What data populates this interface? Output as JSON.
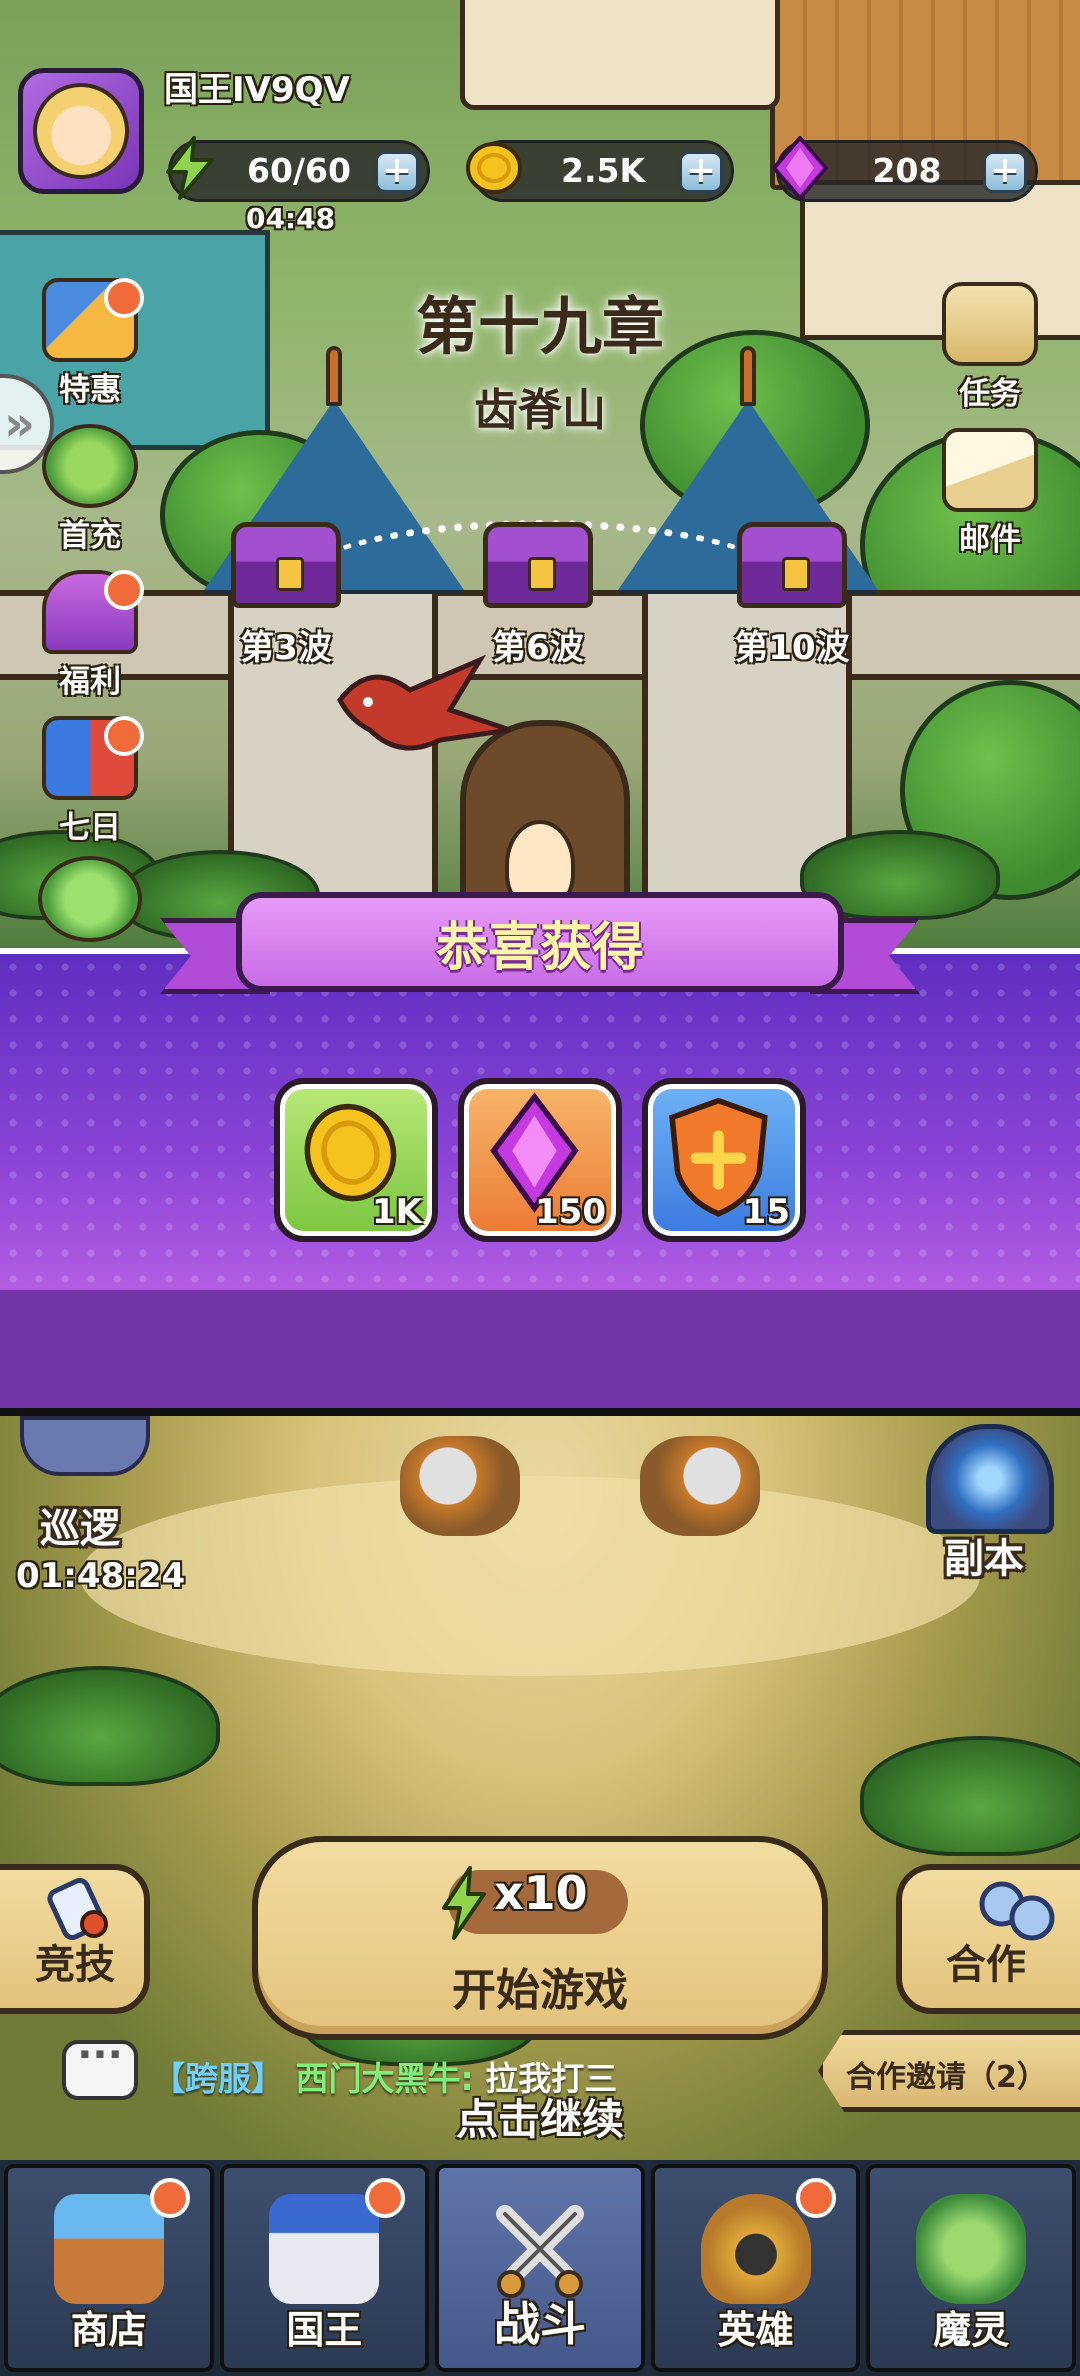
{
  "player": {
    "name": "国王IV9QV"
  },
  "resources": {
    "energy": {
      "value": "60/60",
      "timer": "04:48"
    },
    "gold": {
      "value": "2.5K"
    },
    "gems": {
      "value": "208"
    }
  },
  "chapter": {
    "title": "第十九章",
    "name": "齿脊山"
  },
  "left_menu": [
    {
      "label": "特惠",
      "badge": true
    },
    {
      "label": "首充",
      "badge": false
    },
    {
      "label": "福利",
      "badge": true
    },
    {
      "label": "七日",
      "badge": true
    }
  ],
  "right_menu": [
    {
      "label": "任务"
    },
    {
      "label": "邮件"
    }
  ],
  "wave_chests": [
    {
      "label": "第3波"
    },
    {
      "label": "第6波"
    },
    {
      "label": "第10波"
    }
  ],
  "reward_popup": {
    "title": "恭喜获得",
    "items": [
      {
        "icon": "gold-coin-icon",
        "count": "1K"
      },
      {
        "icon": "purple-gem-icon",
        "count": "150"
      },
      {
        "icon": "shield-icon",
        "count": "15"
      }
    ]
  },
  "patrol": {
    "label": "巡逻",
    "timer": "01:48:24"
  },
  "dungeon": {
    "label": "副本"
  },
  "start_game": {
    "cost": "x10",
    "label": "开始游戏"
  },
  "arena": {
    "label": "竞技"
  },
  "coop": {
    "label": "合作",
    "invite_label": "合作邀请（2）"
  },
  "chat": {
    "channel": "【跨服】",
    "sender": "西门大黑牛:",
    "message": "拉我打三"
  },
  "continue_hint": "点击继续",
  "bottom_nav": [
    {
      "label": "商店",
      "badge": true,
      "active": false
    },
    {
      "label": "国王",
      "badge": true,
      "active": false
    },
    {
      "label": "战斗",
      "badge": false,
      "active": true
    },
    {
      "label": "英雄",
      "badge": true,
      "active": false
    },
    {
      "label": "魔灵",
      "badge": false,
      "active": false
    }
  ],
  "colors": {
    "popup_top": "#5f2ec0",
    "popup_bottom": "#d774f0",
    "badge": "#f06a3a",
    "nav_bg": "#2c3a54"
  }
}
